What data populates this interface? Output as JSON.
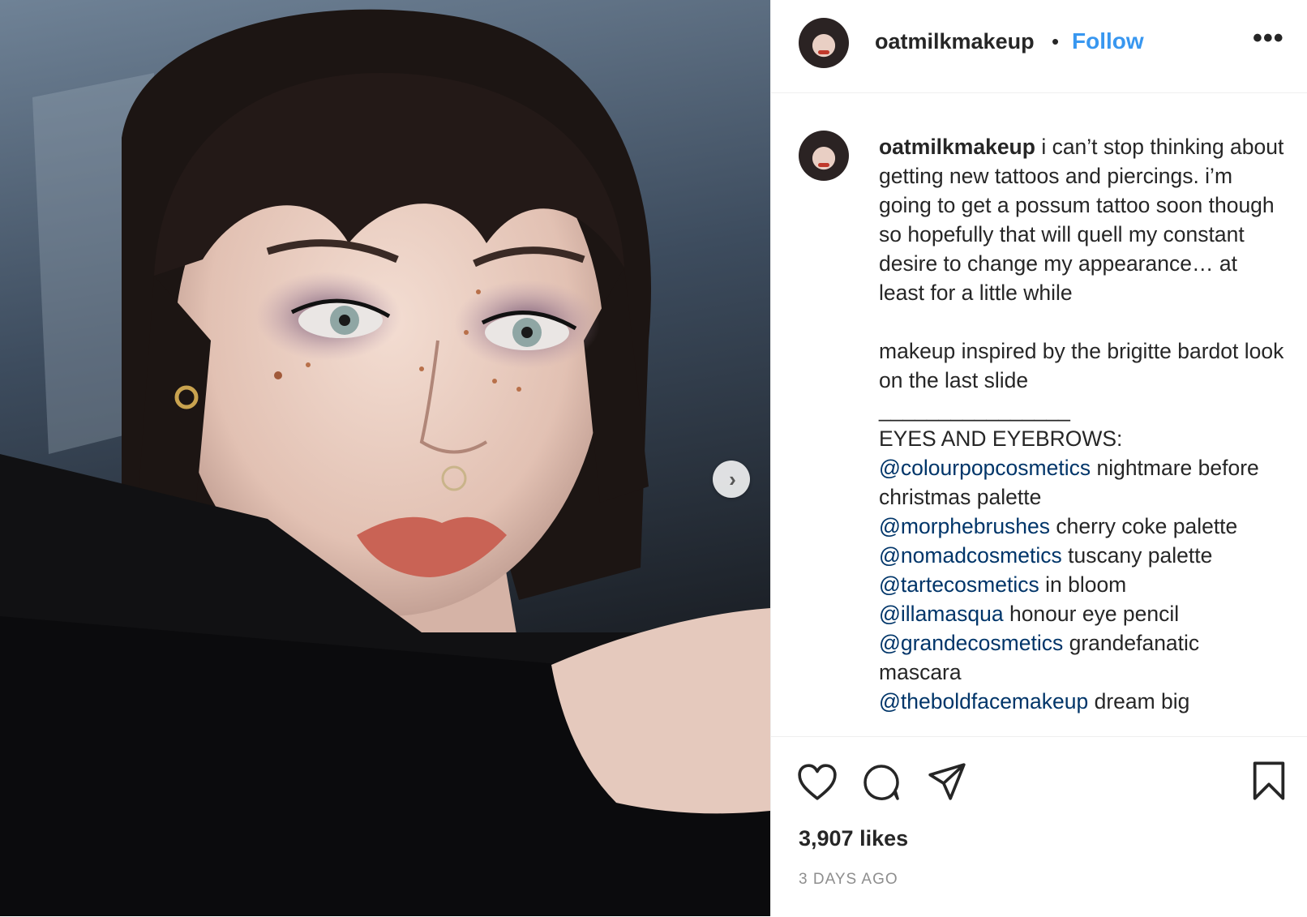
{
  "post": {
    "username": "oatmilkmakeup",
    "separator": "•",
    "follow_label": "Follow",
    "more_label": "•••",
    "next_label": "›"
  },
  "caption": {
    "username": "oatmilkmakeup",
    "paragraph1": "i can’t stop thinking about getting new tattoos and piercings. i’m going to get a possum tattoo soon though so hopefully that will quell my constant desire to change my appearance… at least for a little while",
    "paragraph2": "makeup inspired by the brigitte bardot look on the last slide",
    "divider": "________________",
    "section_heading": "EYES AND EYEBROWS:",
    "products": [
      {
        "mention": "@colourpopcosmetics",
        "text": " nightmare before christmas palette"
      },
      {
        "mention": "@morphebrushes",
        "text": " cherry coke palette"
      },
      {
        "mention": "@nomadcosmetics",
        "text": " tuscany palette"
      },
      {
        "mention": "@tartecosmetics",
        "text": " in bloom"
      },
      {
        "mention": "@illamasqua",
        "text": " honour eye pencil"
      },
      {
        "mention": "@grandecosmetics",
        "text": " grandefanatic mascara"
      },
      {
        "mention": "@theboldfacemakeup",
        "text": " dream big"
      }
    ]
  },
  "stats": {
    "likes": "3,907 likes",
    "time_ago": "3 DAYS AGO"
  },
  "icons": [
    "heart-icon",
    "comment-icon",
    "share-icon",
    "bookmark-icon",
    "chevron-right-icon"
  ],
  "colors": {
    "follow": "#3897f0",
    "mention": "#003569",
    "text": "#262626",
    "muted": "#8e8e8e"
  }
}
